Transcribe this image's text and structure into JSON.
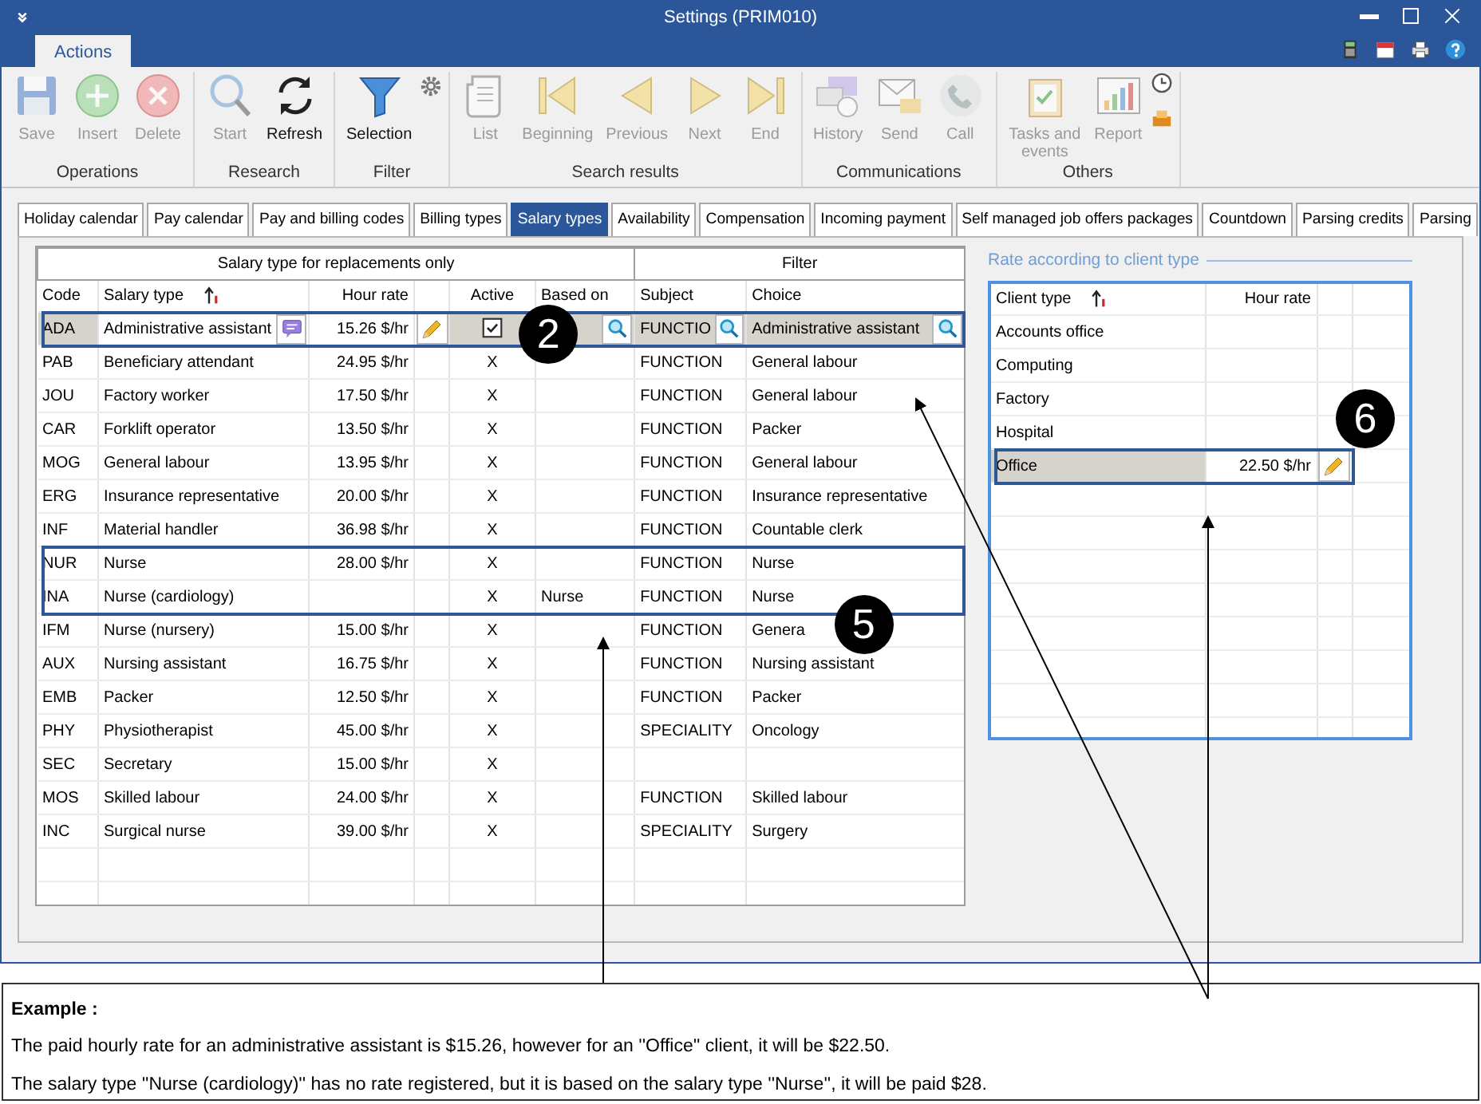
{
  "window": {
    "title": "Settings (PRIM010)"
  },
  "ribbon_tabs": [
    {
      "label": "Actions",
      "selected": true
    }
  ],
  "ribbon_groups": [
    {
      "label": "Operations",
      "buttons": [
        {
          "label": "Save",
          "disabled": true
        },
        {
          "label": "Insert",
          "disabled": true
        },
        {
          "label": "Delete",
          "disabled": true
        }
      ]
    },
    {
      "label": "Research",
      "buttons": [
        {
          "label": "Start",
          "disabled": true
        },
        {
          "label": "Refresh",
          "disabled": false
        }
      ]
    },
    {
      "label": "Filter",
      "buttons": [
        {
          "label": "Selection",
          "disabled": false
        }
      ]
    },
    {
      "label": "Search results",
      "buttons": [
        {
          "label": "List",
          "disabled": true
        },
        {
          "label": "Beginning",
          "disabled": true
        },
        {
          "label": "Previous",
          "disabled": true
        },
        {
          "label": "Next",
          "disabled": true
        },
        {
          "label": "End",
          "disabled": true
        }
      ]
    },
    {
      "label": "Communications",
      "buttons": [
        {
          "label": "History",
          "disabled": true
        },
        {
          "label": "Send",
          "disabled": true
        },
        {
          "label": "Call",
          "disabled": true
        }
      ]
    },
    {
      "label": "Others",
      "buttons": [
        {
          "label": "Tasks and events",
          "disabled": true
        },
        {
          "label": "Report",
          "disabled": true
        }
      ]
    }
  ],
  "tabs": [
    {
      "label": "Holiday calendar",
      "selected": false
    },
    {
      "label": "Pay calendar",
      "selected": false
    },
    {
      "label": "Pay and billing codes",
      "selected": false
    },
    {
      "label": "Billing types",
      "selected": false
    },
    {
      "label": "Salary types",
      "selected": true
    },
    {
      "label": "Availability",
      "selected": false
    },
    {
      "label": "Compensation",
      "selected": false
    },
    {
      "label": "Incoming payment",
      "selected": false
    },
    {
      "label": "Self managed job offers packages",
      "selected": false
    },
    {
      "label": "Countdown",
      "selected": false
    },
    {
      "label": "Parsing credits",
      "selected": false
    },
    {
      "label": "Parsing",
      "selected": false
    }
  ],
  "salary_table": {
    "groups": [
      "Salary type for replacements only",
      "Filter"
    ],
    "columns": [
      "Code",
      "Salary type",
      "Hour rate",
      "Active",
      "Based on",
      "Subject",
      "Choice"
    ],
    "rows": [
      {
        "code": "ADA",
        "salary_type": "Administrative assistant",
        "hour_rate": "15.26 $/hr",
        "checked": true,
        "subject": "FUNCTIO",
        "choice": "Administrative assistant",
        "selected": true
      },
      {
        "code": "PAB",
        "salary_type": "Beneficiary attendant",
        "hour_rate": "24.95 $/hr",
        "active": "X",
        "subject": "FUNCTION",
        "choice": "General labour",
        "selected": false
      },
      {
        "code": "JOU",
        "salary_type": "Factory worker",
        "hour_rate": "17.50 $/hr",
        "active": "X",
        "subject": "FUNCTION",
        "choice": "General labour",
        "selected": false
      },
      {
        "code": "CAR",
        "salary_type": "Forklift operator",
        "hour_rate": "13.50 $/hr",
        "active": "X",
        "subject": "FUNCTION",
        "choice": "Packer",
        "selected": false
      },
      {
        "code": "MOG",
        "salary_type": "General labour",
        "hour_rate": "13.95 $/hr",
        "active": "X",
        "subject": "FUNCTION",
        "choice": "General labour",
        "selected": false
      },
      {
        "code": "ERG",
        "salary_type": "Insurance representative",
        "hour_rate": "20.00 $/hr",
        "active": "X",
        "subject": "FUNCTION",
        "choice": "Insurance representative",
        "selected": false
      },
      {
        "code": "INF",
        "salary_type": "Material handler",
        "hour_rate": "36.98 $/hr",
        "active": "X",
        "subject": "FUNCTION",
        "choice": "Countable clerk",
        "selected": false
      },
      {
        "code": "NUR",
        "salary_type": "Nurse",
        "hour_rate": "28.00 $/hr",
        "active": "X",
        "subject": "FUNCTION",
        "choice": "Nurse",
        "selected": false
      },
      {
        "code": "INA",
        "salary_type": "Nurse (cardiology)",
        "active": "X",
        "based_on": "Nurse",
        "subject": "FUNCTION",
        "choice": "Nurse",
        "selected": false
      },
      {
        "code": "IFM",
        "salary_type": "Nurse (nursery)",
        "hour_rate": "15.00 $/hr",
        "active": "X",
        "subject": "FUNCTION",
        "choice": "Genera",
        "selected": false
      },
      {
        "code": "AUX",
        "salary_type": "Nursing assistant",
        "hour_rate": "16.75 $/hr",
        "active": "X",
        "subject": "FUNCTION",
        "choice": "Nursing assistant",
        "selected": false
      },
      {
        "code": "EMB",
        "salary_type": "Packer",
        "hour_rate": "12.50 $/hr",
        "active": "X",
        "subject": "FUNCTION",
        "choice": "Packer",
        "selected": false
      },
      {
        "code": "PHY",
        "salary_type": "Physiotherapist",
        "hour_rate": "45.00 $/hr",
        "active": "X",
        "subject": "SPECIALITY",
        "choice": "Oncology",
        "selected": false
      },
      {
        "code": "SEC",
        "salary_type": "Secretary",
        "hour_rate": "15.00 $/hr",
        "active": "X",
        "selected": false
      },
      {
        "code": "MOS",
        "salary_type": "Skilled labour",
        "hour_rate": "24.00 $/hr",
        "active": "X",
        "subject": "FUNCTION",
        "choice": "Skilled labour",
        "selected": false
      },
      {
        "code": "INC",
        "salary_type": "Surgical nurse",
        "hour_rate": "39.00 $/hr",
        "active": "X",
        "subject": "SPECIALITY",
        "choice": "Surgery",
        "selected": false
      }
    ]
  },
  "client_rates": {
    "title": "Rate according to client type",
    "columns": [
      "Client type",
      "Hour rate"
    ],
    "rows": [
      {
        "client_type": "Accounts office",
        "selected": false
      },
      {
        "client_type": "Computing",
        "selected": false
      },
      {
        "client_type": "Factory",
        "selected": false
      },
      {
        "client_type": "Hospital",
        "selected": false
      },
      {
        "client_type": "Office",
        "hour_rate": "22.50 $/hr",
        "selected": true
      }
    ]
  },
  "annotations": [
    {
      "label": "2"
    },
    {
      "label": "5"
    },
    {
      "label": "6"
    }
  ],
  "example": {
    "title": "Example :",
    "lines": [
      "The paid hourly rate for an administrative assistant is $15.26, however for an ''Office'' client, it will be $22.50.",
      "The salary type ''Nurse (cardiology)'' has no rate registered, but it is based on the salary type ''Nurse'', it will be paid $28."
    ]
  }
}
